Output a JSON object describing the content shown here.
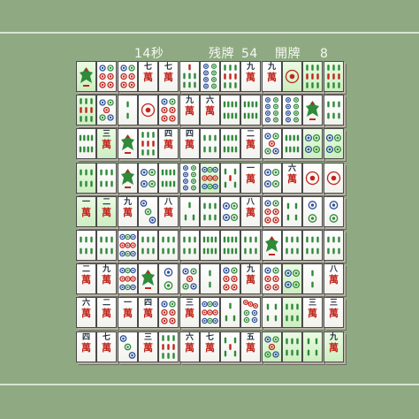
{
  "hud": {
    "time_value": "14秒",
    "remaining_label": "残牌",
    "remaining_value": "54",
    "open_label": "開牌",
    "open_value": "8"
  },
  "legend_note": "",
  "board": {
    "rows": [
      [
        "s1",
        "p6",
        "p6",
        "m7",
        "m7",
        "s7",
        "p8",
        "s9",
        "m9",
        "m9",
        "p1",
        "s9",
        "s9"
      ],
      [
        "s9",
        "p5",
        "s2",
        "p1",
        "p6",
        "m9",
        "m6",
        "s8",
        "s8",
        "p8",
        "p8",
        "s1",
        "s6"
      ],
      [
        "s8",
        "m3",
        "s1",
        "s9",
        "m4",
        "m4",
        "s6",
        "s8",
        "m2",
        "p5",
        "s8",
        "p4",
        "p4"
      ],
      [
        "s6",
        "s6",
        "s1",
        "p4",
        "s8",
        "p8",
        "p9",
        "s5",
        "m1",
        "p4",
        "m6",
        "p1",
        "p1"
      ],
      [
        "m1",
        "m2",
        "m9",
        "p3",
        "m8",
        "s3",
        "s6",
        "p4",
        "m8",
        "p6",
        "s4",
        "p2",
        "p2"
      ],
      [
        "s6",
        "s6",
        "p9",
        "s6",
        "s6",
        "s6",
        "s8",
        "s8",
        "s6",
        "s1",
        "s6",
        "s6",
        "s6"
      ],
      [
        "m2",
        "m9",
        "p9",
        "s1",
        "p2",
        "p5",
        "s2",
        "p6",
        "m9",
        "p6",
        "p4",
        "s2",
        "m8"
      ],
      [
        "m6",
        "m2",
        "m1",
        "m4",
        "p6",
        "m3",
        "p9",
        "s3",
        "p7",
        "s4",
        "s6",
        "m3",
        "m3"
      ],
      [
        "m4",
        "m7",
        "p3",
        "m3",
        "s9",
        "m6",
        "m7",
        "s5",
        "m5",
        "p5",
        "s6",
        "s4",
        "m9"
      ]
    ],
    "highlighted_tiles": [
      [
        0,
        0
      ],
      [
        0,
        10
      ],
      [
        0,
        11
      ],
      [
        0,
        12
      ],
      [
        1,
        0
      ],
      [
        2,
        1
      ],
      [
        2,
        11
      ],
      [
        2,
        12
      ],
      [
        3,
        0
      ],
      [
        3,
        6
      ],
      [
        4,
        0
      ],
      [
        4,
        1
      ],
      [
        6,
        10
      ],
      [
        7,
        10
      ],
      [
        8,
        9
      ],
      [
        8,
        10
      ],
      [
        8,
        11
      ],
      [
        8,
        12
      ]
    ]
  },
  "colors": {
    "background": "#8faa83",
    "bamboo_green": "#2f8a3a",
    "circle_blue": "#2b4f9a",
    "circle_red": "#c0261c",
    "character_red": "#c0261c",
    "tile_face": "#ffffff",
    "highlight_face": "#d6f2cc"
  },
  "kanji_numerals": {
    "1": "一",
    "2": "二",
    "3": "三",
    "4": "四",
    "5": "五",
    "6": "六",
    "7": "七",
    "8": "八",
    "9": "九"
  },
  "character_glyph": "萬"
}
